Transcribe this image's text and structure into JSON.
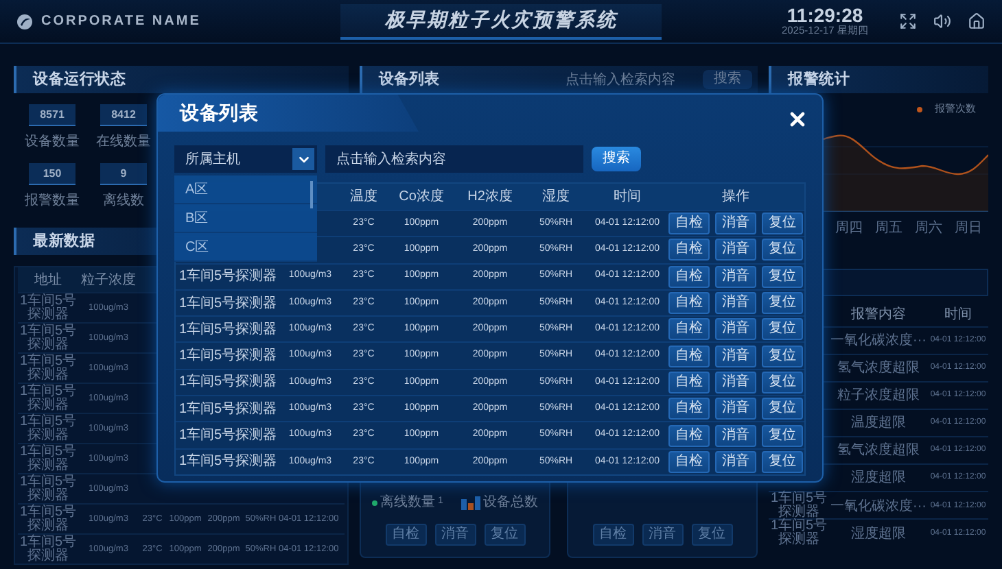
{
  "header": {
    "brand": "CORPORATE NAME",
    "title": "极早期粒子火灾预警系统",
    "time": "11:29:28",
    "date": "2025-12-17 星期四"
  },
  "status_panel": {
    "title": "设备运行状态",
    "stats": [
      {
        "value": "8571",
        "label": "设备数量"
      },
      {
        "value": "8412",
        "label": "在线数量"
      },
      {
        "value": "150",
        "label": "报警数量"
      },
      {
        "value": "9",
        "label": "离线数"
      }
    ]
  },
  "latest_panel": {
    "title": "最新数据",
    "columns": [
      "地址",
      "粒子浓度"
    ],
    "rows": [
      [
        "1车间5号探测器",
        "100ug/m3"
      ],
      [
        "1车间5号探测器",
        "100ug/m3"
      ],
      [
        "1车间5号探测器",
        "100ug/m3"
      ],
      [
        "1车间5号探测器",
        "100ug/m3"
      ],
      [
        "1车间5号探测器",
        "100ug/m3"
      ],
      [
        "1车间5号探测器",
        "100ug/m3"
      ],
      [
        "1车间5号探测器",
        "100ug/m3"
      ],
      [
        "1车间5号探测器",
        "100ug/m3",
        "23°C",
        "100ppm",
        "200ppm",
        "50%RH",
        "04-01 12:12:00"
      ],
      [
        "1车间5号探测器",
        "100ug/m3",
        "23°C",
        "100ppm",
        "200ppm",
        "50%RH",
        "04-01 12:12:00"
      ]
    ]
  },
  "device_panel": {
    "title": "设备列表",
    "search": {
      "placeholder": "点击输入检索内容"
    },
    "search_button": "搜索",
    "cards": [
      {
        "legend": "离线数量",
        "count": "1",
        "total_label": "设备总数",
        "buttons": [
          "自检",
          "消音",
          "复位"
        ]
      },
      {
        "buttons": [
          "自检",
          "消音",
          "复位"
        ]
      }
    ]
  },
  "alarm_panel": {
    "title": "报警统计",
    "legend": "报警次数",
    "days": [
      "周四",
      "周五",
      "周六",
      "周日"
    ],
    "columns": [
      "报警内容",
      "时间"
    ],
    "rows": [
      {
        "cells": [
          "一氧化碳浓度···",
          "04-01 12:12:00"
        ]
      },
      {
        "cells": [
          "氢气浓度超限",
          "04-01 12:12:00"
        ]
      },
      {
        "cells": [
          "粒子浓度超限",
          "04-01 12:12:00"
        ]
      },
      {
        "cells": [
          "温度超限",
          "04-01 12:12:00"
        ]
      },
      {
        "cells": [
          "氢气浓度超限",
          "04-01 12:12:00"
        ]
      },
      {
        "cells": [
          "湿度超限",
          "04-01 12:12:00"
        ]
      },
      {
        "cells": [
          "1车间5号探测器",
          "一氧化碳浓度···",
          "04-01 12:12:00"
        ]
      },
      {
        "cells": [
          "1车间5号探测器",
          "湿度超限",
          "04-01 12:12:00"
        ]
      }
    ]
  },
  "modal": {
    "title": "设备列表",
    "host_select": {
      "value": "所属主机",
      "expanded": true,
      "options": [
        "A区",
        "B区",
        "C区"
      ]
    },
    "search": {
      "placeholder": "点击输入检索内容"
    },
    "search_button": "搜索",
    "columns": [
      "温度",
      "Co浓度",
      "H2浓度",
      "湿度",
      "时间",
      "操作"
    ],
    "rows": [
      {
        "cells": [
          "23°C",
          "100ppm",
          "200ppm",
          "50%RH",
          "04-01 12:12:00"
        ],
        "actions": [
          "自检",
          "消音",
          "复位"
        ]
      },
      {
        "cells": [
          "23°C",
          "100ppm",
          "200ppm",
          "50%RH",
          "04-01 12:12:00"
        ],
        "actions": [
          "自检",
          "消音",
          "复位"
        ]
      },
      {
        "cells": [
          "1车间5号探测器",
          "100ug/m3",
          "23°C",
          "100ppm",
          "200ppm",
          "50%RH",
          "04-01 12:12:00"
        ],
        "actions": [
          "自检",
          "消音",
          "复位"
        ]
      },
      {
        "cells": [
          "1车间5号探测器",
          "100ug/m3",
          "23°C",
          "100ppm",
          "200ppm",
          "50%RH",
          "04-01 12:12:00"
        ],
        "actions": [
          "自检",
          "消音",
          "复位"
        ]
      },
      {
        "cells": [
          "1车间5号探测器",
          "100ug/m3",
          "23°C",
          "100ppm",
          "200ppm",
          "50%RH",
          "04-01 12:12:00"
        ],
        "actions": [
          "自检",
          "消音",
          "复位"
        ]
      },
      {
        "cells": [
          "1车间5号探测器",
          "100ug/m3",
          "23°C",
          "100ppm",
          "200ppm",
          "50%RH",
          "04-01 12:12:00"
        ],
        "actions": [
          "自检",
          "消音",
          "复位"
        ]
      },
      {
        "cells": [
          "1车间5号探测器",
          "100ug/m3",
          "23°C",
          "100ppm",
          "200ppm",
          "50%RH",
          "04-01 12:12:00"
        ],
        "actions": [
          "自检",
          "消音",
          "复位"
        ]
      },
      {
        "cells": [
          "1车间5号探测器",
          "100ug/m3",
          "23°C",
          "100ppm",
          "200ppm",
          "50%RH",
          "04-01 12:12:00"
        ],
        "actions": [
          "自检",
          "消音",
          "复位"
        ]
      },
      {
        "cells": [
          "1车间5号探测器",
          "100ug/m3",
          "23°C",
          "100ppm",
          "200ppm",
          "50%RH",
          "04-01 12:12:00"
        ],
        "actions": [
          "自检",
          "消音",
          "复位"
        ]
      },
      {
        "cells": [
          "1车间5号探测器",
          "100ug/m3",
          "23°C",
          "100ppm",
          "200ppm",
          "50%RH",
          "04-01 12:12:00"
        ],
        "actions": [
          "自检",
          "消音",
          "复位"
        ]
      }
    ]
  }
}
